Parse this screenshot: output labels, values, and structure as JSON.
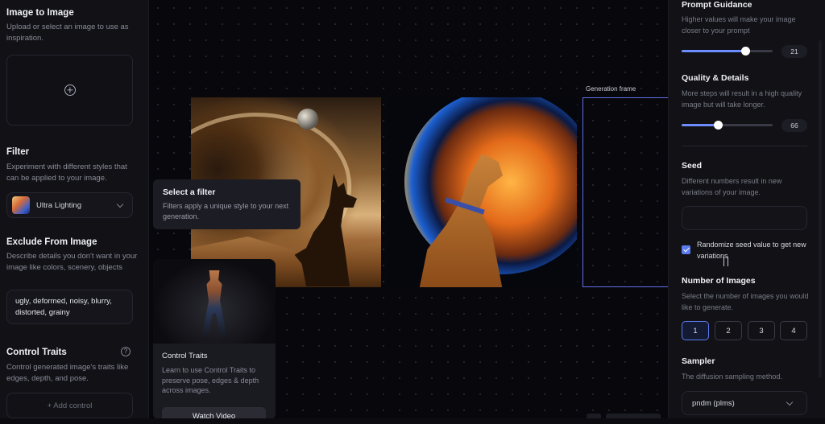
{
  "left_panel": {
    "image_to_image": {
      "title": "Image to Image",
      "desc": "Upload or select an image to use as inspiration."
    },
    "filter": {
      "title": "Filter",
      "desc": "Experiment with different styles that can be applied to your image.",
      "selected": "Ultra Lighting"
    },
    "exclude": {
      "title": "Exclude From Image",
      "desc": "Describe details you don't want in your image like colors, scenery, objects",
      "value": "ugly, deformed, noisy, blurry, distorted, grainy"
    },
    "control_traits": {
      "title": "Control Traits",
      "desc": "Control generated image's traits like edges, depth, and pose.",
      "help": "?",
      "add_label": "+ Add control"
    }
  },
  "canvas": {
    "generation_frame_label": "Generation frame",
    "tooltip": {
      "title": "Select a filter",
      "desc": "Filters apply a unique style to your next generation."
    },
    "video_card": {
      "title": "Control Traits",
      "desc": "Learn to use Control Traits to preserve pose, edges & depth across images.",
      "button": "Watch Video"
    }
  },
  "right_panel": {
    "prompt_guidance": {
      "title": "Prompt Guidance",
      "desc": "Higher values will make your image closer to your prompt",
      "value": "21",
      "fraction": 0.7
    },
    "quality": {
      "title": "Quality & Details",
      "desc": "More steps will result in a high quality image but will take longer.",
      "value": "66",
      "fraction": 0.4
    },
    "seed": {
      "title": "Seed",
      "desc": "Different numbers result in new variations of your image.",
      "value": "",
      "randomize_label": "Randomize seed value to get new variations",
      "randomize_checked": true
    },
    "num_images": {
      "title": "Number of Images",
      "desc": "Select the number of images you would like to generate.",
      "options": [
        "1",
        "2",
        "3",
        "4"
      ],
      "selected": "1"
    },
    "sampler": {
      "title": "Sampler",
      "desc": "The diffusion sampling method.",
      "selected": "pndm (plms)"
    }
  },
  "colors": {
    "accent": "#5b7bf0",
    "panel_bg": "#111116",
    "canvas_bg": "#07070c"
  }
}
